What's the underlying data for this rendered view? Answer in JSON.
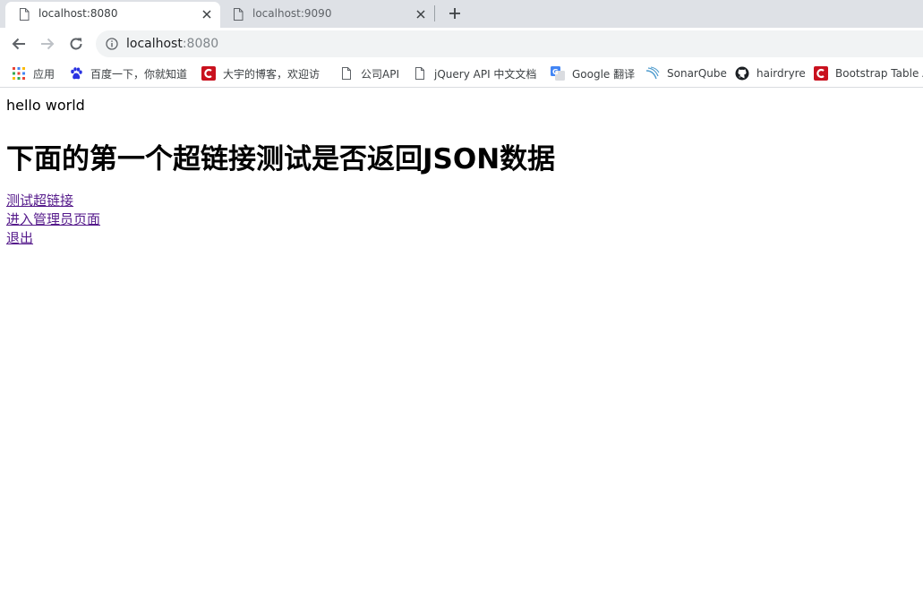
{
  "tabs": [
    {
      "title": "localhost:8080",
      "active": true,
      "icon": "page-icon"
    },
    {
      "title": "localhost:9090",
      "active": false,
      "icon": "page-icon"
    }
  ],
  "toolbar": {
    "url_host": "localhost",
    "url_port": ":8080"
  },
  "bookmarks": [
    {
      "label": "应用",
      "icon": "apps-grid-icon"
    },
    {
      "label": "百度一下，你就知道",
      "icon": "baidu-paw-icon"
    },
    {
      "label": "大宇的博客，欢迎访",
      "icon": "csdn-c-icon"
    },
    {
      "label": "公司API",
      "icon": "page-icon"
    },
    {
      "label": "jQuery API 中文文档",
      "icon": "page-icon"
    },
    {
      "label": "Google 翻译",
      "icon": "google-translate-icon"
    },
    {
      "label": "SonarQube",
      "icon": "sonarqube-icon"
    },
    {
      "label": "hairdryre",
      "icon": "github-icon"
    },
    {
      "label": "Bootstrap Table AP",
      "icon": "csdn-c-icon"
    }
  ],
  "page": {
    "hello": "hello world",
    "heading": "下面的第一个超链接测试是否返回JSON数据",
    "links": [
      "测试超链接",
      "进入管理员页面",
      "退出"
    ]
  },
  "colors": {
    "tabstrip": "#dee1e6",
    "link_visited": "#551a8b",
    "csdn_red": "#c9111e"
  }
}
